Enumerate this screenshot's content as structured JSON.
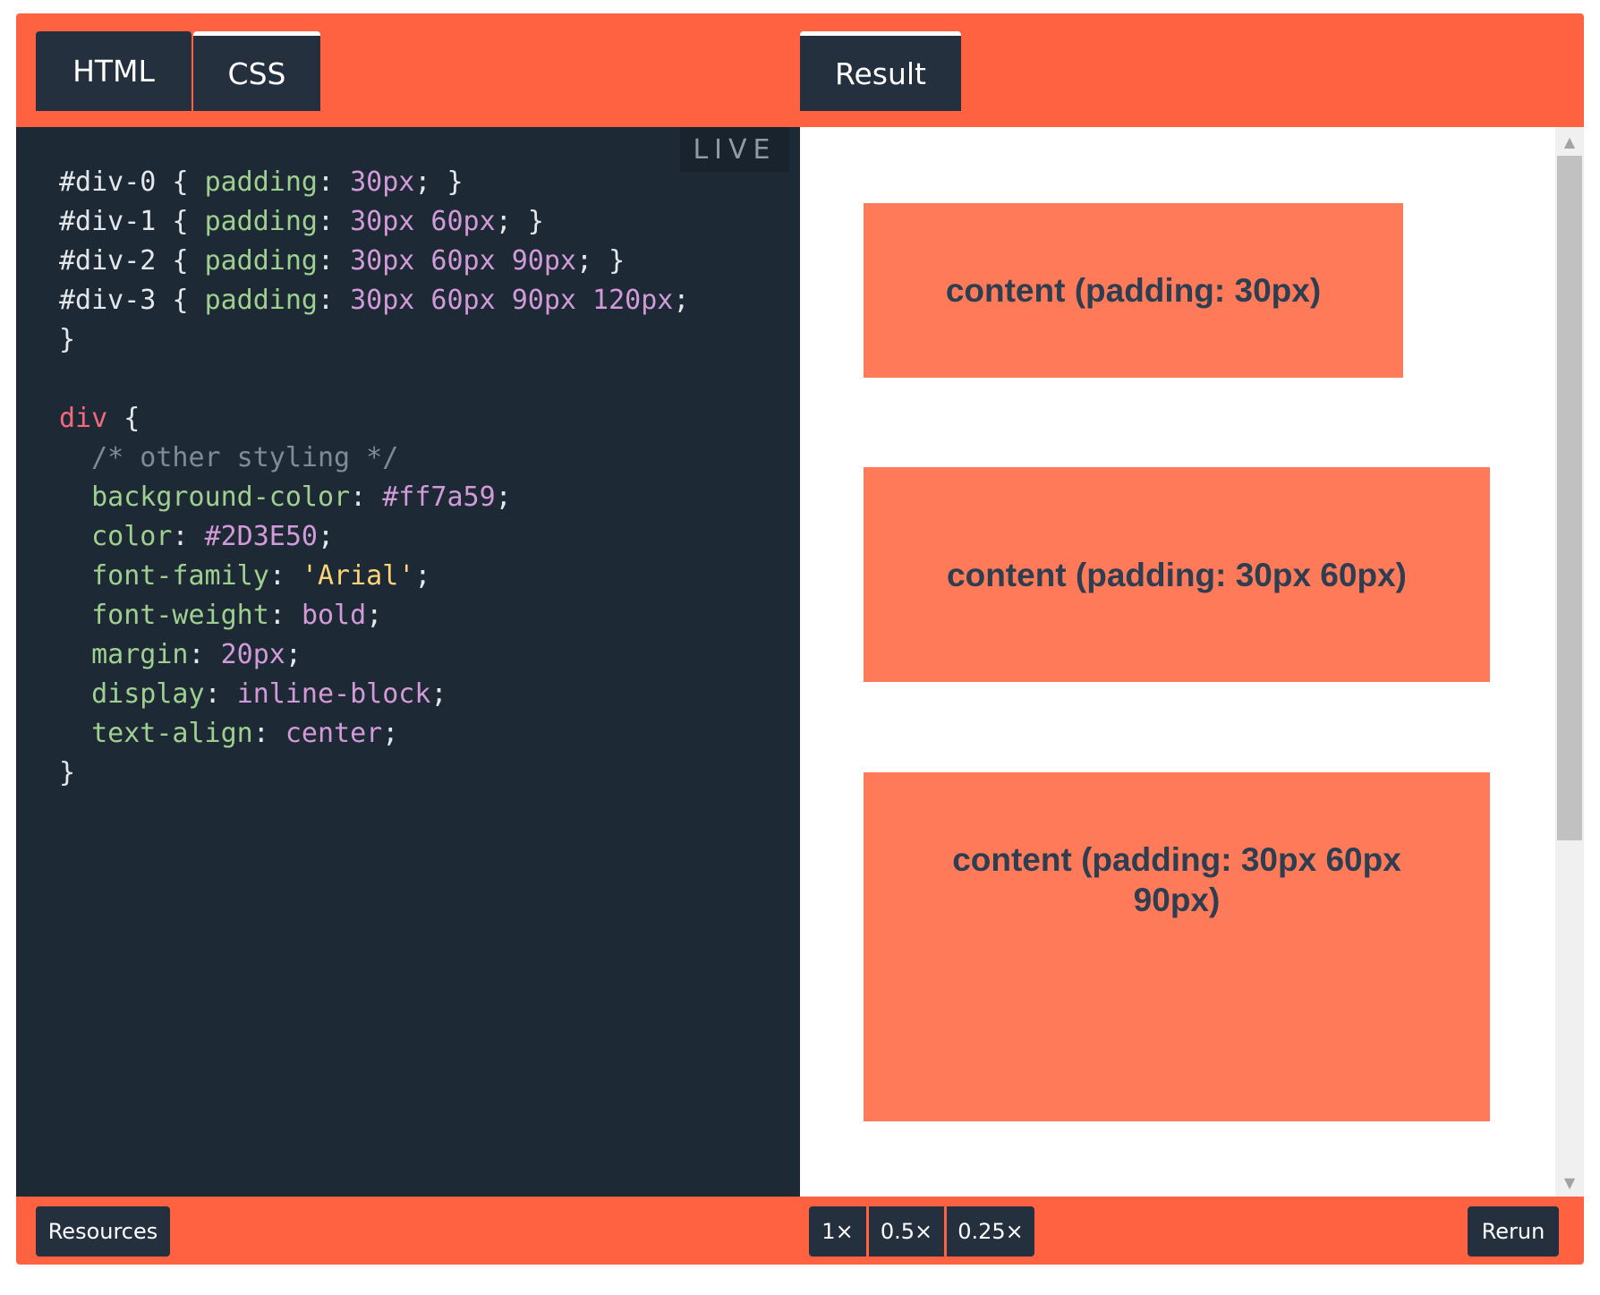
{
  "tabs": {
    "html": "HTML",
    "css": "CSS",
    "result": "Result"
  },
  "editor": {
    "live_badge": "LIVE",
    "lines": [
      [
        {
          "t": "#div-0 ",
          "c": "sel"
        },
        {
          "t": "{ ",
          "c": "punc"
        },
        {
          "t": "padding",
          "c": "prop"
        },
        {
          "t": ": ",
          "c": "punc"
        },
        {
          "t": "30px",
          "c": "val"
        },
        {
          "t": "; }",
          "c": "punc"
        }
      ],
      [
        {
          "t": "#div-1 ",
          "c": "sel"
        },
        {
          "t": "{ ",
          "c": "punc"
        },
        {
          "t": "padding",
          "c": "prop"
        },
        {
          "t": ": ",
          "c": "punc"
        },
        {
          "t": "30px 60px",
          "c": "val"
        },
        {
          "t": "; }",
          "c": "punc"
        }
      ],
      [
        {
          "t": "#div-2 ",
          "c": "sel"
        },
        {
          "t": "{ ",
          "c": "punc"
        },
        {
          "t": "padding",
          "c": "prop"
        },
        {
          "t": ": ",
          "c": "punc"
        },
        {
          "t": "30px 60px 90px",
          "c": "val"
        },
        {
          "t": "; }",
          "c": "punc"
        }
      ],
      [
        {
          "t": "#div-3 ",
          "c": "sel"
        },
        {
          "t": "{ ",
          "c": "punc"
        },
        {
          "t": "padding",
          "c": "prop"
        },
        {
          "t": ": ",
          "c": "punc"
        },
        {
          "t": "30px 60px 90px 120px",
          "c": "val"
        },
        {
          "t": ";",
          "c": "punc"
        }
      ],
      [
        {
          "t": "}",
          "c": "punc"
        }
      ],
      [],
      [
        {
          "t": "div",
          "c": "tag"
        },
        {
          "t": " {",
          "c": "punc"
        }
      ],
      [
        {
          "t": "  /* other styling */",
          "c": "com"
        }
      ],
      [
        {
          "t": "  background-color",
          "c": "prop"
        },
        {
          "t": ": ",
          "c": "punc"
        },
        {
          "t": "#ff7a59",
          "c": "val"
        },
        {
          "t": ";",
          "c": "punc"
        }
      ],
      [
        {
          "t": "  color",
          "c": "prop"
        },
        {
          "t": ": ",
          "c": "punc"
        },
        {
          "t": "#2D3E50",
          "c": "val"
        },
        {
          "t": ";",
          "c": "punc"
        }
      ],
      [
        {
          "t": "  font-family",
          "c": "prop"
        },
        {
          "t": ": ",
          "c": "punc"
        },
        {
          "t": "'Arial'",
          "c": "str"
        },
        {
          "t": ";",
          "c": "punc"
        }
      ],
      [
        {
          "t": "  font-weight",
          "c": "prop"
        },
        {
          "t": ": ",
          "c": "punc"
        },
        {
          "t": "bold",
          "c": "val"
        },
        {
          "t": ";",
          "c": "punc"
        }
      ],
      [
        {
          "t": "  margin",
          "c": "prop"
        },
        {
          "t": ": ",
          "c": "punc"
        },
        {
          "t": "20px",
          "c": "val"
        },
        {
          "t": ";",
          "c": "punc"
        }
      ],
      [
        {
          "t": "  display",
          "c": "prop"
        },
        {
          "t": ": ",
          "c": "punc"
        },
        {
          "t": "inline-block",
          "c": "val"
        },
        {
          "t": ";",
          "c": "punc"
        }
      ],
      [
        {
          "t": "  text-align",
          "c": "prop"
        },
        {
          "t": ": ",
          "c": "punc"
        },
        {
          "t": "center",
          "c": "val"
        },
        {
          "t": ";",
          "c": "punc"
        }
      ],
      [
        {
          "t": "}",
          "c": "punc"
        }
      ]
    ]
  },
  "result": {
    "boxes": [
      "content (padding: 30px)",
      "content (padding: 30px 60px)",
      "content (padding: 30px 60px 90px)"
    ]
  },
  "footer": {
    "resources": "Resources",
    "zoom_options": [
      "1×",
      "0.5×",
      "0.25×"
    ],
    "rerun": "Rerun"
  },
  "colors": {
    "frame": "#ff6240",
    "tab_bg": "#25303f",
    "editor_bg": "#1d2934",
    "box_bg": "#ff7a59",
    "box_text": "#2d3e50"
  },
  "icons": {
    "scroll_up": "triangle-up",
    "scroll_down": "triangle-down"
  }
}
